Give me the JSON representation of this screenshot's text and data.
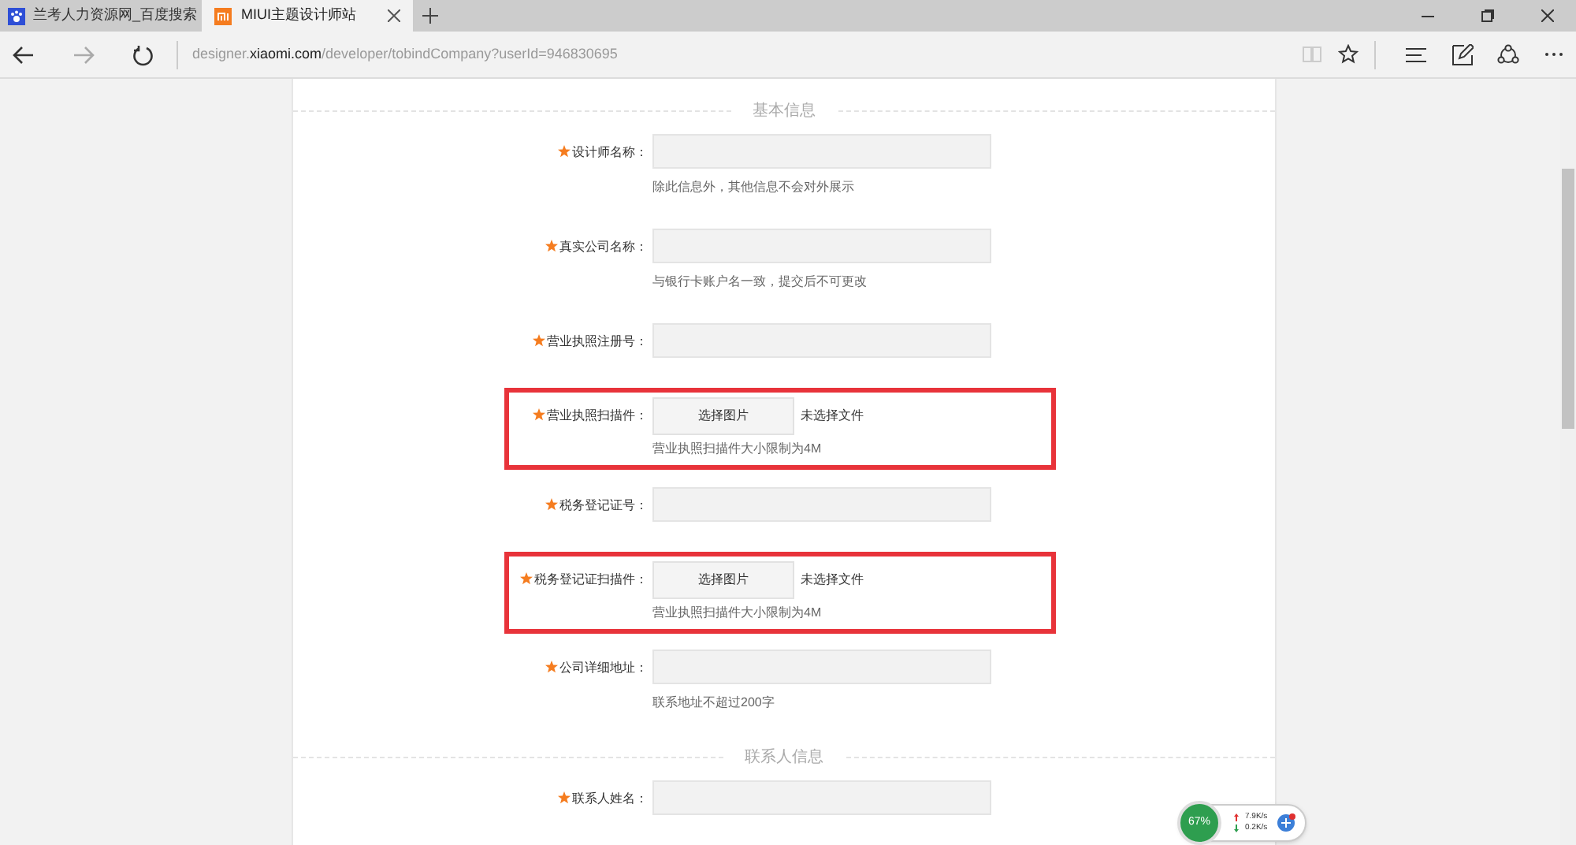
{
  "tabs": [
    {
      "title": "兰考人力资源网_百度搜索",
      "selected": false
    },
    {
      "title": "MIUI主题设计师站",
      "selected": true
    }
  ],
  "address_bar": {
    "prefix": "designer.",
    "domain": "xiaomi.com",
    "path": "/developer/tobindCompany?userId=946830695"
  },
  "sections": [
    {
      "title": "基本信息",
      "fields": [
        {
          "kind": "text",
          "label": "设计师名称：",
          "required": true,
          "hint": "除此信息外，其他信息不会对外展示",
          "highlighted": false
        },
        {
          "kind": "text",
          "label": "真实公司名称：",
          "required": true,
          "hint": "与银行卡账户名一致，提交后不可更改",
          "highlighted": false
        },
        {
          "kind": "text",
          "label": "营业执照注册号：",
          "required": true,
          "highlighted": false
        },
        {
          "kind": "file",
          "label": "营业执照扫描件：",
          "required": true,
          "button": "选择图片",
          "status": "未选择文件",
          "hint": "营业执照扫描件大小限制为4M",
          "highlighted": true
        },
        {
          "kind": "text",
          "label": "税务登记证号：",
          "required": true,
          "highlighted": false
        },
        {
          "kind": "file",
          "label": "税务登记证扫描件：",
          "required": true,
          "button": "选择图片",
          "status": "未选择文件",
          "hint": "营业执照扫描件大小限制为4M",
          "highlighted": true
        },
        {
          "kind": "text",
          "label": "公司详细地址：",
          "required": true,
          "hint": "联系地址不超过200字",
          "highlighted": false
        }
      ]
    },
    {
      "title": "联系人信息",
      "fields": [
        {
          "kind": "text",
          "label": "联系人姓名：",
          "required": true,
          "highlighted": false
        }
      ]
    }
  ],
  "net_monitor": {
    "percent": "67%",
    "upload": "7.9K/s",
    "download": "0.2K/s"
  }
}
